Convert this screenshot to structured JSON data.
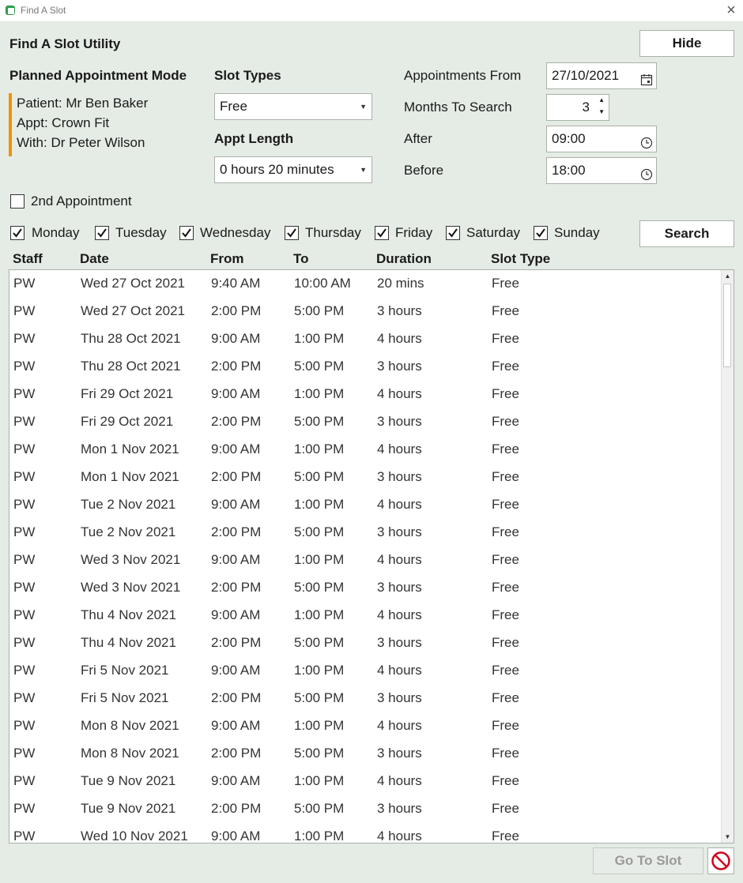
{
  "window": {
    "title": "Find A Slot"
  },
  "header": {
    "title": "Find A Slot Utility",
    "hide_label": "Hide"
  },
  "mode": {
    "title": "Planned Appointment Mode",
    "patient": "Patient: Mr Ben Baker",
    "appt": "Appt: Crown Fit",
    "with": "With: Dr Peter Wilson",
    "accent_color": "#f29100"
  },
  "slot_types": {
    "label": "Slot Types",
    "value": "Free"
  },
  "appt_length": {
    "label": "Appt Length",
    "value": "0 hours 20 minutes"
  },
  "appointments_from": {
    "label": "Appointments From",
    "value": "27/10/2021"
  },
  "months_to_search": {
    "label": "Months To Search",
    "value": "3"
  },
  "after": {
    "label": "After",
    "value": "09:00"
  },
  "before": {
    "label": "Before",
    "value": "18:00"
  },
  "second_appointment": {
    "label": "2nd Appointment",
    "checked": false
  },
  "days": [
    {
      "label": "Monday",
      "checked": true
    },
    {
      "label": "Tuesday",
      "checked": true
    },
    {
      "label": "Wednesday",
      "checked": true
    },
    {
      "label": "Thursday",
      "checked": true
    },
    {
      "label": "Friday",
      "checked": true
    },
    {
      "label": "Saturday",
      "checked": true
    },
    {
      "label": "Sunday",
      "checked": true
    }
  ],
  "search_label": "Search",
  "table": {
    "columns": [
      "Staff",
      "Date",
      "From",
      "To",
      "Duration",
      "Slot Type"
    ],
    "rows": [
      [
        "PW",
        "Wed 27 Oct 2021",
        "9:40 AM",
        "10:00 AM",
        "20 mins",
        "Free"
      ],
      [
        "PW",
        "Wed 27 Oct 2021",
        "2:00 PM",
        "5:00 PM",
        "3 hours",
        "Free"
      ],
      [
        "PW",
        "Thu 28 Oct 2021",
        "9:00 AM",
        "1:00 PM",
        "4 hours",
        "Free"
      ],
      [
        "PW",
        "Thu 28 Oct 2021",
        "2:00 PM",
        "5:00 PM",
        "3 hours",
        "Free"
      ],
      [
        "PW",
        "Fri 29 Oct 2021",
        "9:00 AM",
        "1:00 PM",
        "4 hours",
        "Free"
      ],
      [
        "PW",
        "Fri 29 Oct 2021",
        "2:00 PM",
        "5:00 PM",
        "3 hours",
        "Free"
      ],
      [
        "PW",
        "Mon 1 Nov 2021",
        "9:00 AM",
        "1:00 PM",
        "4 hours",
        "Free"
      ],
      [
        "PW",
        "Mon 1 Nov 2021",
        "2:00 PM",
        "5:00 PM",
        "3 hours",
        "Free"
      ],
      [
        "PW",
        "Tue 2 Nov 2021",
        "9:00 AM",
        "1:00 PM",
        "4 hours",
        "Free"
      ],
      [
        "PW",
        "Tue 2 Nov 2021",
        "2:00 PM",
        "5:00 PM",
        "3 hours",
        "Free"
      ],
      [
        "PW",
        "Wed 3 Nov 2021",
        "9:00 AM",
        "1:00 PM",
        "4 hours",
        "Free"
      ],
      [
        "PW",
        "Wed 3 Nov 2021",
        "2:00 PM",
        "5:00 PM",
        "3 hours",
        "Free"
      ],
      [
        "PW",
        "Thu 4 Nov 2021",
        "9:00 AM",
        "1:00 PM",
        "4 hours",
        "Free"
      ],
      [
        "PW",
        "Thu 4 Nov 2021",
        "2:00 PM",
        "5:00 PM",
        "3 hours",
        "Free"
      ],
      [
        "PW",
        "Fri 5 Nov 2021",
        "9:00 AM",
        "1:00 PM",
        "4 hours",
        "Free"
      ],
      [
        "PW",
        "Fri 5 Nov 2021",
        "2:00 PM",
        "5:00 PM",
        "3 hours",
        "Free"
      ],
      [
        "PW",
        "Mon 8 Nov 2021",
        "9:00 AM",
        "1:00 PM",
        "4 hours",
        "Free"
      ],
      [
        "PW",
        "Mon 8 Nov 2021",
        "2:00 PM",
        "5:00 PM",
        "3 hours",
        "Free"
      ],
      [
        "PW",
        "Tue 9 Nov 2021",
        "9:00 AM",
        "1:00 PM",
        "4 hours",
        "Free"
      ],
      [
        "PW",
        "Tue 9 Nov 2021",
        "2:00 PM",
        "5:00 PM",
        "3 hours",
        "Free"
      ],
      [
        "PW",
        "Wed 10 Nov 2021",
        "9:00 AM",
        "1:00 PM",
        "4 hours",
        "Free"
      ]
    ]
  },
  "footer": {
    "go_label": "Go To Slot",
    "cancel_icon": "no-entry-icon"
  },
  "colors": {
    "background": "#e5ece5",
    "cancel": "#d0021b",
    "disabled_text": "#9a9a9a"
  }
}
